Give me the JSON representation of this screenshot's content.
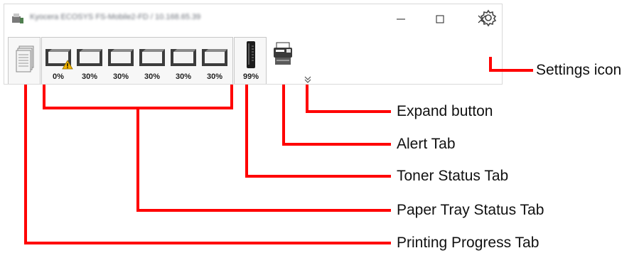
{
  "window": {
    "title": "Kyocera ECOSYS FS-Mobile2-FD / 10.168.65.39",
    "controls": {
      "minimize": "—",
      "maximize": "☐",
      "close": "✕"
    }
  },
  "tabs": {
    "printing_progress": {
      "icon": "pages-stack-icon"
    },
    "paper_trays": [
      {
        "percent": "0%",
        "warning": true
      },
      {
        "percent": "30%",
        "warning": false
      },
      {
        "percent": "30%",
        "warning": false
      },
      {
        "percent": "30%",
        "warning": false
      },
      {
        "percent": "30%",
        "warning": false
      },
      {
        "percent": "30%",
        "warning": false
      }
    ],
    "toner": {
      "percent": "99%"
    },
    "alert": {
      "icon": "printer-icon"
    }
  },
  "callouts": {
    "settings_icon": "Settings icon",
    "expand_button": "Expand button",
    "alert_tab": "Alert Tab",
    "toner_status_tab": "Toner Status Tab",
    "paper_tray_status_tab": "Paper Tray Status Tab",
    "printing_progress_tab": "Printing Progress Tab"
  },
  "colors": {
    "callout_line": "#ff0000",
    "warning": "#f2b300",
    "tray_dark": "#3c3c3c"
  }
}
